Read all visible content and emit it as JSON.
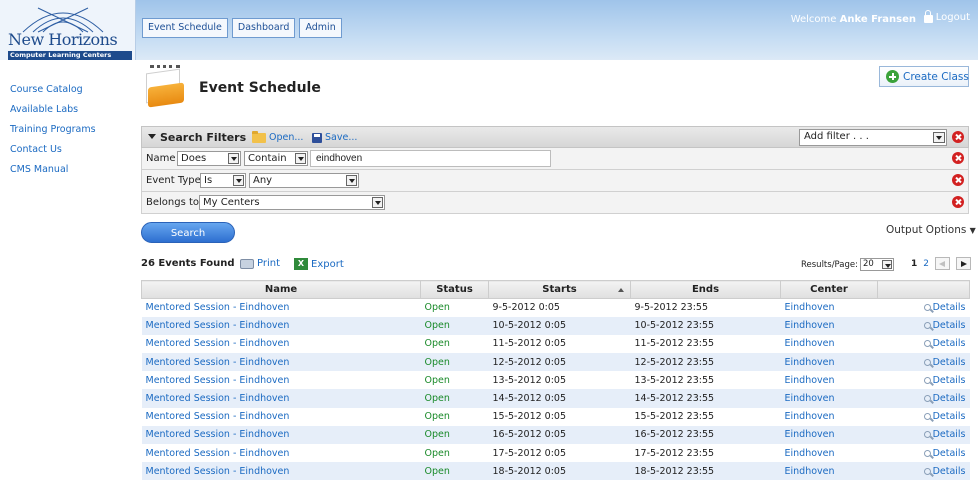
{
  "header": {
    "logo_text": "New Horizons",
    "logo_tagline": "Computer Learning Centers",
    "nav_tabs": [
      "Event Schedule",
      "Dashboard",
      "Admin"
    ],
    "welcome_prefix": "Welcome",
    "user_name": "Anke Fransen",
    "logout_label": "Logout"
  },
  "sidebar": {
    "items": [
      "Course Catalog",
      "Available Labs",
      "Training Programs",
      "Contact Us",
      "CMS Manual"
    ]
  },
  "page": {
    "title": "Event Schedule",
    "create_button": "Create Class"
  },
  "filters": {
    "title": "Search Filters",
    "open_label": "Open...",
    "save_label": "Save...",
    "add_filter_placeholder": "Add filter . . .",
    "name_row": {
      "label": "Name",
      "op1": "Does",
      "op2": "Contain",
      "value": "eindhoven"
    },
    "type_row": {
      "label": "Event Type",
      "op": "Is",
      "value": "Any"
    },
    "belongs_row": {
      "label": "Belongs to",
      "value": "My Centers"
    }
  },
  "actions": {
    "search_button": "Search",
    "output_options": "Output Options"
  },
  "results": {
    "found_text": "26 Events Found",
    "print_label": "Print",
    "export_label": "Export",
    "per_page_label": "Results/Page:",
    "per_page_value": "20",
    "current_page": "1",
    "next_page": "2"
  },
  "table": {
    "columns": [
      "Name",
      "Status",
      "Starts",
      "Ends",
      "Center",
      ""
    ],
    "details_label": "Details",
    "rows": [
      {
        "name": "Mentored Session - Eindhoven",
        "status": "Open",
        "starts": "9-5-2012 0:05",
        "ends": "9-5-2012 23:55",
        "center": "Eindhoven"
      },
      {
        "name": "Mentored Session - Eindhoven",
        "status": "Open",
        "starts": "10-5-2012 0:05",
        "ends": "10-5-2012 23:55",
        "center": "Eindhoven"
      },
      {
        "name": "Mentored Session - Eindhoven",
        "status": "Open",
        "starts": "11-5-2012 0:05",
        "ends": "11-5-2012 23:55",
        "center": "Eindhoven"
      },
      {
        "name": "Mentored Session - Eindhoven",
        "status": "Open",
        "starts": "12-5-2012 0:05",
        "ends": "12-5-2012 23:55",
        "center": "Eindhoven"
      },
      {
        "name": "Mentored Session - Eindhoven",
        "status": "Open",
        "starts": "13-5-2012 0:05",
        "ends": "13-5-2012 23:55",
        "center": "Eindhoven"
      },
      {
        "name": "Mentored Session - Eindhoven",
        "status": "Open",
        "starts": "14-5-2012 0:05",
        "ends": "14-5-2012 23:55",
        "center": "Eindhoven"
      },
      {
        "name": "Mentored Session - Eindhoven",
        "status": "Open",
        "starts": "15-5-2012 0:05",
        "ends": "15-5-2012 23:55",
        "center": "Eindhoven"
      },
      {
        "name": "Mentored Session - Eindhoven",
        "status": "Open",
        "starts": "16-5-2012 0:05",
        "ends": "16-5-2012 23:55",
        "center": "Eindhoven"
      },
      {
        "name": "Mentored Session - Eindhoven",
        "status": "Open",
        "starts": "17-5-2012 0:05",
        "ends": "17-5-2012 23:55",
        "center": "Eindhoven"
      },
      {
        "name": "Mentored Session - Eindhoven",
        "status": "Open",
        "starts": "18-5-2012 0:05",
        "ends": "18-5-2012 23:55",
        "center": "Eindhoven"
      }
    ]
  },
  "colors": {
    "link": "#1b6ac2",
    "status_open": "#1a8a2a",
    "row_alt": "#e6eef9",
    "delete": "#d22121",
    "create": "#3aa23a"
  }
}
